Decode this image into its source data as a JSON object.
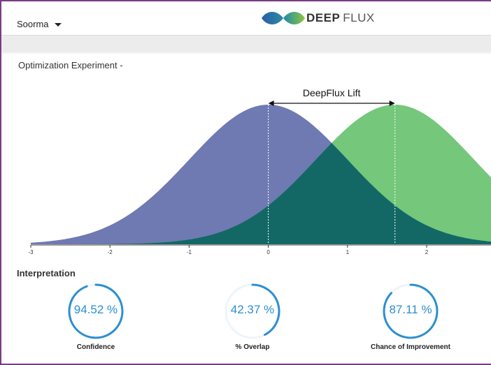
{
  "header": {
    "user_label": "Soorma",
    "brand_bold": "DEEP",
    "brand_light": "FLUX",
    "colors": {
      "brand_blue": "#2a5da8",
      "brand_green": "#8dc63f"
    }
  },
  "panel": {
    "title": "Optimization Experiment -"
  },
  "chart_data": {
    "type": "area",
    "annotation": "DeepFlux Lift",
    "x_ticks": [
      "-3",
      "-2",
      "-1",
      "0",
      "1",
      "2"
    ],
    "xlim": [
      -3,
      2.9
    ],
    "series": [
      {
        "mean": 0,
        "sd": 1,
        "color": "#6f79b2"
      },
      {
        "mean": 1.6,
        "sd": 1,
        "color": "#74c77b"
      }
    ],
    "overlap_color": "#136866",
    "grid": false
  },
  "interpretation": {
    "title": "Interpretation",
    "gauges": [
      {
        "value": "94.52 %",
        "label": "Confidence",
        "fraction": 0.9452
      },
      {
        "value": "42.37 %",
        "label": "% Overlap",
        "fraction": 0.4237
      },
      {
        "value": "87.11 %",
        "label": "Chance of Improvement",
        "fraction": 0.8711
      }
    ],
    "gauge_color": "#2c8fd0"
  }
}
